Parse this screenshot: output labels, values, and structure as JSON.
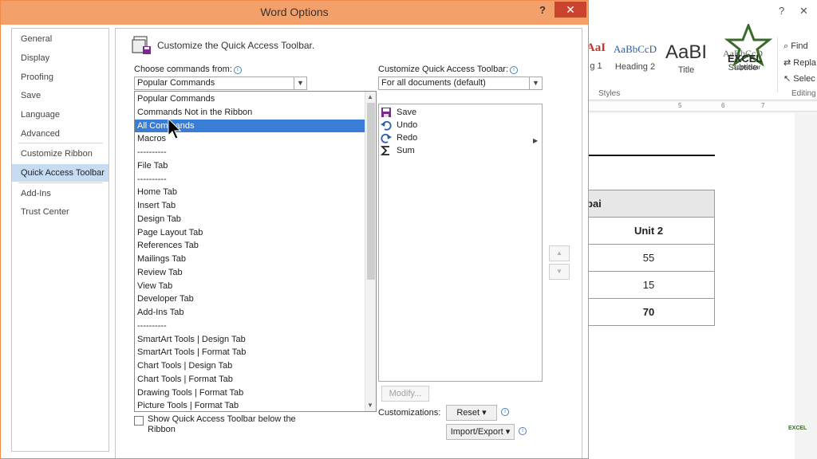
{
  "dialog": {
    "title": "Word Options",
    "help_label": "?",
    "close_label": "✕"
  },
  "nav": {
    "items": [
      "General",
      "Display",
      "Proofing",
      "Save",
      "Language",
      "Advanced",
      "Customize Ribbon",
      "Quick Access Toolbar",
      "Add-Ins",
      "Trust Center"
    ],
    "active": "Quick Access Toolbar"
  },
  "content": {
    "heading": "Customize the Quick Access Toolbar.",
    "choose_label": "Choose commands from:",
    "choose_value": "Popular Commands",
    "customize_label": "Customize Quick Access Toolbar:",
    "customize_value": "For all documents (default)",
    "dropdown_options": [
      "Popular Commands",
      "Commands Not in the Ribbon",
      "All Commands",
      "Macros",
      "----------",
      "File Tab",
      "----------",
      "Home Tab",
      "Insert Tab",
      "Design Tab",
      "Page Layout Tab",
      "References Tab",
      "Mailings Tab",
      "Review Tab",
      "View Tab",
      "Developer Tab",
      "Add-Ins Tab",
      "----------",
      "SmartArt Tools | Design Tab",
      "SmartArt Tools | Format Tab",
      "Chart Tools | Design Tab",
      "Chart Tools | Format Tab",
      "Drawing Tools | Format Tab",
      "Picture Tools | Format Tab"
    ],
    "selected_option": "All Commands",
    "qat_items": [
      {
        "label": "Save",
        "icon": "save-icon"
      },
      {
        "label": "Undo",
        "icon": "undo-icon"
      },
      {
        "label": "Redo",
        "icon": "redo-icon"
      },
      {
        "label": "Sum",
        "icon": "sum-icon"
      }
    ],
    "modify_label": "Modify...",
    "customizations_label": "Customizations:",
    "reset_label": "Reset ▾",
    "import_export_label": "Import/Export ▾",
    "show_below_label": "Show Quick Access Toolbar below the Ribbon",
    "move_up_label": "▲",
    "move_down_label": "▼"
  },
  "word_window": {
    "help_label": "?",
    "close_label": "✕",
    "styles": [
      {
        "sample": "AaI",
        "label": "g 1"
      },
      {
        "sample": "AaBbCcD",
        "label": "Heading 2"
      },
      {
        "sample": "AaBI",
        "label": "Title"
      },
      {
        "sample": "AaBbCcD",
        "label": "Subtitle"
      }
    ],
    "styles_group": "Styles",
    "editing_group": "Editing",
    "editing_buttons": [
      "Find",
      "Repla",
      "Selec"
    ],
    "ruler_numbers": [
      "5",
      "6",
      "7"
    ],
    "table": {
      "header": "bai",
      "column": "Unit 2",
      "values": [
        "55",
        "15",
        "70"
      ]
    },
    "logo_text": "EXCEL",
    "logo_sub": "superstar",
    "logo_small": "EXCEL"
  },
  "colors": {
    "title_bar": "#f4a06b",
    "close_red": "#c9432f",
    "selection_blue": "#3a7dd6",
    "nav_active": "#c5dcf2",
    "logo_green": "#3a6a2a"
  }
}
